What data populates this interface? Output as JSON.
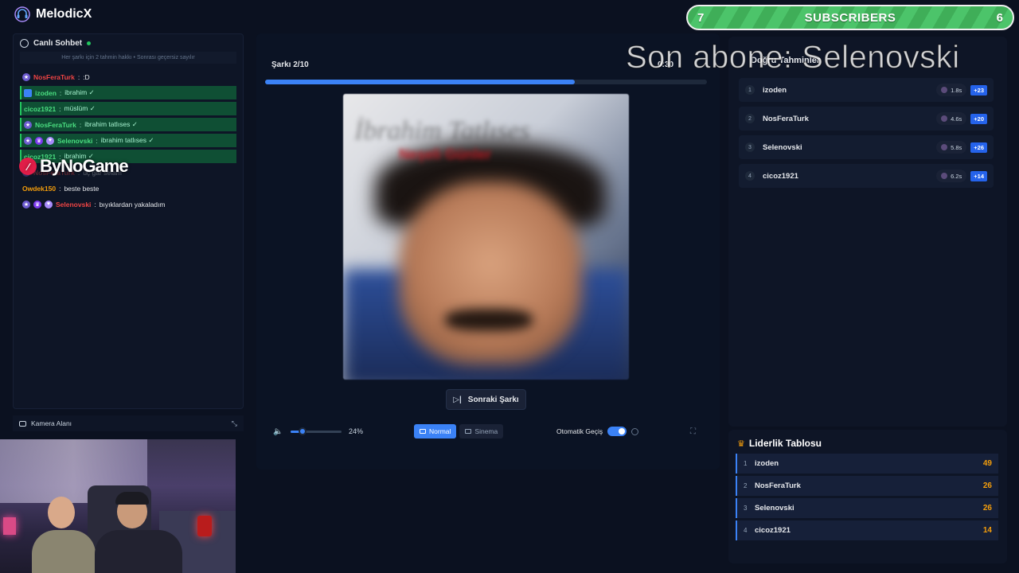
{
  "app": {
    "title": "MelodicX"
  },
  "subscribers": {
    "left": "7",
    "label": "SUBSCRIBERS",
    "right": "6"
  },
  "overlay": {
    "last_sub": "Son abone: Selenovski"
  },
  "watermark": "ByNoGame",
  "chat": {
    "title": "Canlı Sohbet",
    "note": "Her şarkı için 2 tahmin hakkı • Sonrası geçersiz sayılır",
    "messages": [
      {
        "user": "NosFeraTurk",
        "text": ":D"
      },
      {
        "user": "izoden",
        "text": "ibrahim ✓"
      },
      {
        "user": "cicoz1921",
        "text": "müslüm ✓"
      },
      {
        "user": "NosFeraTurk",
        "text": "ibrahim tatlıses ✓"
      },
      {
        "user": "Selenovski",
        "text": "ibrahim tatlıses ✓"
      },
      {
        "user": "cicoz1921",
        "text": "ibrahim ✓"
      },
      {
        "user": "NosFeraTurk",
        "text": "üç gar selam"
      },
      {
        "user": "Owdek150",
        "text": "beste beste"
      },
      {
        "user": "Selenovski",
        "text": "bıyıklardan yakaladım"
      }
    ]
  },
  "camera": {
    "label": "Kamera Alanı"
  },
  "player": {
    "song_counter": "Şarkı 2/10",
    "timer": "0:30",
    "progress": 0.7,
    "cover_title": "İbrahim Tatlıses",
    "cover_subtitle": "Neşeli Günler",
    "next_label": "Sonraki Şarkı",
    "volume_pct": "24%",
    "volume": 0.24,
    "mode_normal": "Normal",
    "mode_cinema": "Sinema",
    "auto_label": "Otomatik Geçiş"
  },
  "correct": {
    "title": "Doğru Tahminler",
    "rows": [
      {
        "rank": "1",
        "name": "izoden",
        "time": "1.8s",
        "pts": "+23"
      },
      {
        "rank": "2",
        "name": "NosFeraTurk",
        "time": "4.6s",
        "pts": "+20"
      },
      {
        "rank": "3",
        "name": "Selenovski",
        "time": "5.8s",
        "pts": "+26"
      },
      {
        "rank": "4",
        "name": "cicoz1921",
        "time": "6.2s",
        "pts": "+14"
      }
    ]
  },
  "leaderboard": {
    "title": "Liderlik Tablosu",
    "rows": [
      {
        "rank": "1",
        "name": "izoden",
        "score": "49"
      },
      {
        "rank": "2",
        "name": "NosFeraTurk",
        "score": "26"
      },
      {
        "rank": "3",
        "name": "Selenovski",
        "score": "26"
      },
      {
        "rank": "4",
        "name": "cicoz1921",
        "score": "14"
      }
    ]
  }
}
